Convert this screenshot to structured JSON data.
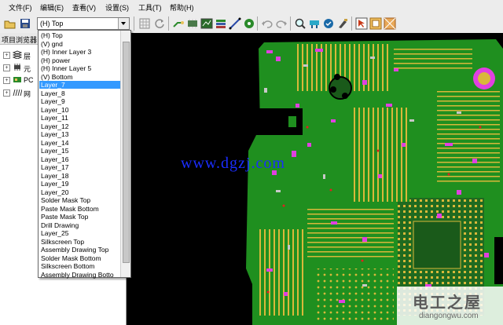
{
  "menu": [
    {
      "label": "文件(F)"
    },
    {
      "label": "编辑(E)"
    },
    {
      "label": "查看(V)"
    },
    {
      "label": "设置(S)"
    },
    {
      "label": "工具(T)"
    },
    {
      "label": "帮助(H)"
    }
  ],
  "toolbar": {
    "layer_select_value": "(H) Top"
  },
  "left_panel": {
    "title": "项目浏览器",
    "tree": [
      {
        "label": "层",
        "icon": "layers-icon"
      },
      {
        "label": "元",
        "icon": "component-icon"
      },
      {
        "label": "PC",
        "icon": "pcb-icon"
      },
      {
        "label": "网",
        "icon": "net-icon"
      }
    ]
  },
  "layer_dropdown": {
    "selected_index": 6,
    "options": [
      "(H) Top",
      "(V) gnd",
      "(H) Inner Layer 3",
      "(H) power",
      "(H) Inner Layer 5",
      "(V) Bottom",
      "Layer_7",
      "Layer_8",
      "Layer_9",
      "Layer_10",
      "Layer_11",
      "Layer_12",
      "Layer_13",
      "Layer_14",
      "Layer_15",
      "Layer_16",
      "Layer_17",
      "Layer_18",
      "Layer_19",
      "Layer_20",
      "Solder Mask Top",
      "Paste Mask Bottom",
      "Paste Mask Top",
      "Drill Drawing",
      "Layer_25",
      "Silkscreen Top",
      "Assembly Drawing Top",
      "Solder Mask Bottom",
      "Silkscreen Bottom",
      "Assembly Drawing Botto"
    ]
  },
  "watermark": "www.dgzj.com",
  "logo": {
    "title": "电工之屋",
    "url": "diangongwu.com"
  },
  "colors": {
    "board_green": "#1f8f1f",
    "trace_yellow": "#d9b83a",
    "pad_magenta": "#e040e0",
    "selection_blue": "#3399ff"
  }
}
